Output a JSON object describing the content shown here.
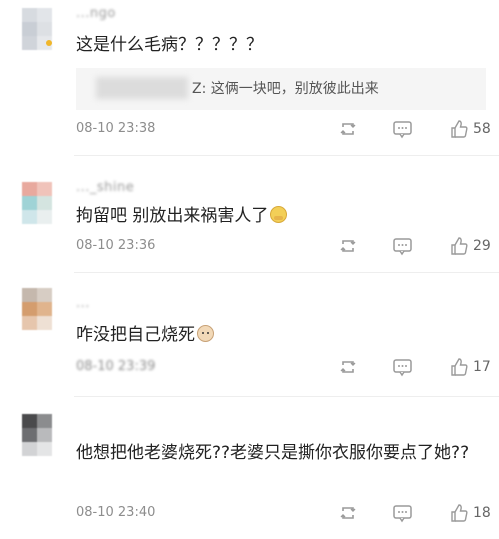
{
  "colors": {
    "text": "#222222",
    "meta": "#8d8d8d",
    "icon": "#9a9a9a",
    "divider": "#eeeeee",
    "quote_bg": "#f5f5f5"
  },
  "comments": [
    {
      "username": "...ngo",
      "text": "这是什么毛病？？？？？",
      "quote": {
        "text": "Z: 这俩一块吧，别放彼此出来"
      },
      "time": "08-10 23:38",
      "likes": "58",
      "avatar_colors": [
        "#d7dbe0",
        "#e2e5e9",
        "#c9ced5",
        "#dde0e4",
        "#d0d4da",
        "#e6e8eb"
      ]
    },
    {
      "username": "..._shine",
      "text": "拘留吧 别放出来祸害人了",
      "emoji": "cover-mouth-emoji",
      "time": "08-10 23:36",
      "likes": "29",
      "avatar_colors": [
        "#e8a99e",
        "#f0c3ba",
        "#9fd3d6",
        "#d4e4e0",
        "#cfe6ea",
        "#e9efef"
      ]
    },
    {
      "username": "...",
      "text": "咋没把自己烧死",
      "emoji": "dog-emoji",
      "time": "08-10 23:39",
      "likes": "17",
      "avatar_colors": [
        "#c5b8ad",
        "#d7cdc4",
        "#d49d6e",
        "#e0b48d",
        "#e6c6ad",
        "#eee0d4"
      ]
    },
    {
      "username": "",
      "text": "他想把他老婆烧死??老婆只是撕你衣服你要点了她??",
      "time": "08-10 23:40",
      "likes": "18",
      "avatar_colors": [
        "#4a4a4c",
        "#8b8c8e",
        "#6d6e71",
        "#b9babc",
        "#d2d3d5",
        "#e4e5e6"
      ]
    }
  ]
}
